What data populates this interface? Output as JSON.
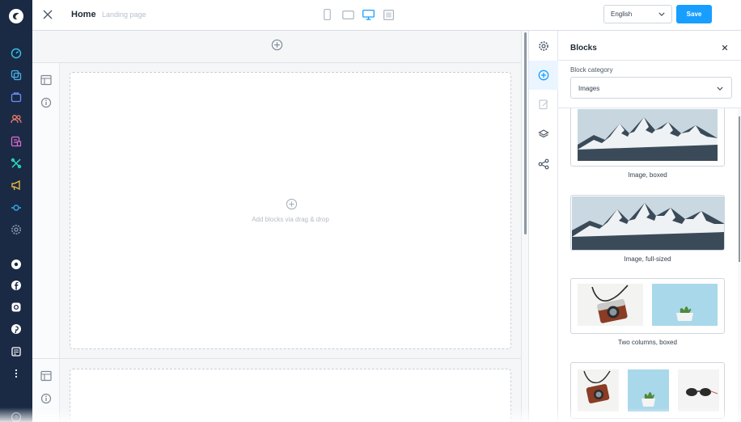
{
  "nav": {
    "icons": [
      "shopware-logo-icon",
      "dashboard-icon",
      "catalogue-icon",
      "orders-icon",
      "customers-icon",
      "content-icon",
      "extensions-icon",
      "marketing-icon",
      "sales-channels-icon",
      "settings-icon",
      "storefront-channel-icon",
      "facebook-icon",
      "instagram-icon",
      "pinterest-icon",
      "pos-icon",
      "more-icon",
      "help-icon"
    ],
    "colors": [
      "#ffffff",
      "#36c2ea",
      "#47b4e8",
      "#6f8ff7",
      "#f07a6d",
      "#e06bd0",
      "#2fd6c2",
      "#f5c342",
      "#35a7e8",
      "#8c9bb0",
      "#ffffff",
      "#ffffff",
      "#ffffff",
      "#ffffff",
      "#ffffff",
      "#ffffff",
      "#8c9bb0"
    ]
  },
  "topbar": {
    "title": "Home",
    "subtitle": "Landing page",
    "devices": [
      "mobile-icon",
      "tablet-icon",
      "desktop-icon",
      "list-view-icon"
    ],
    "active_device": "desktop-icon",
    "language": "English",
    "save_label": "Save"
  },
  "canvas": {
    "drop_text": "Add blocks via drag & drop"
  },
  "sidebar": {
    "tabs": [
      "settings-icon",
      "add-block-icon",
      "edit-icon",
      "layers-icon",
      "share-icon"
    ],
    "active_tab": "add-block-icon"
  },
  "panel": {
    "title": "Blocks",
    "category_label": "Block category",
    "category_value": "Images",
    "blocks": [
      {
        "label": "Image, boxed"
      },
      {
        "label": "Image, full-sized"
      },
      {
        "label": "Two columns, boxed"
      },
      {
        "label": ""
      }
    ]
  },
  "accent_color": "#189eff"
}
